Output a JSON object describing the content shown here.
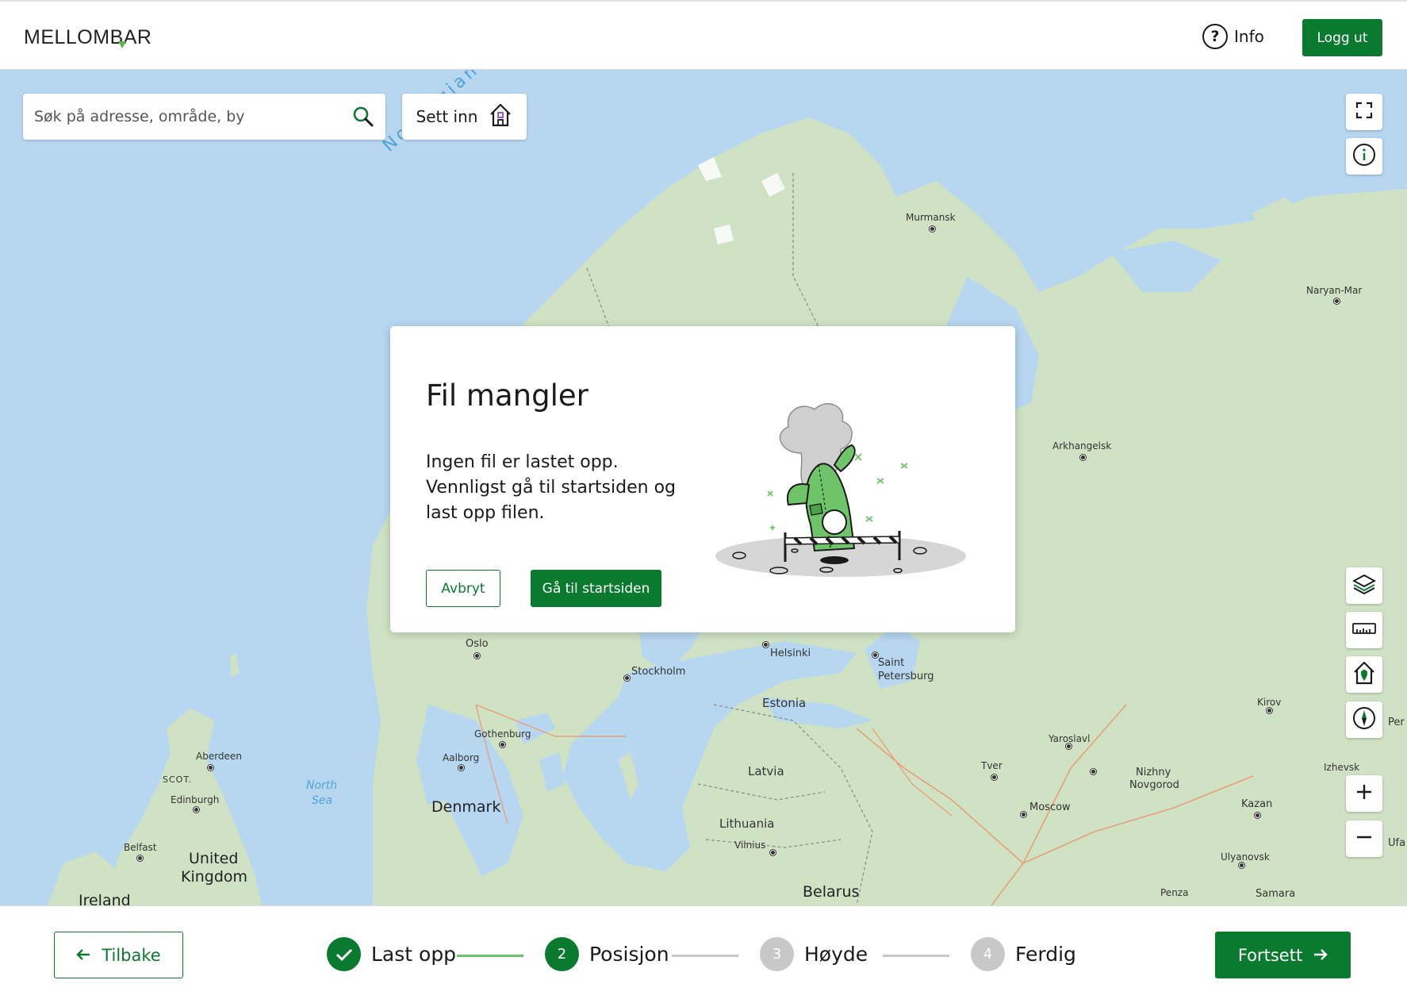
{
  "header": {
    "logo": "MELLOMBAR",
    "info_label": "Info",
    "logout_label": "Logg ut"
  },
  "search": {
    "placeholder": "Søk på adresse, område, by",
    "value": ""
  },
  "insert_button": {
    "label": "Sett inn"
  },
  "map_labels": {
    "sea_norwegian": "Norwegian Se",
    "sea_north_1": "North",
    "sea_north_2": "Sea",
    "murmansk": "Murmansk",
    "naryan_mar": "Naryan-Mar",
    "arkhangelsk": "Arkhangelsk",
    "oslo": "Oslo",
    "stockholm": "Stockholm",
    "helsinki": "Helsinki",
    "saint_1": "Saint",
    "saint_2": "Petersburg",
    "estonia": "Estonia",
    "gothenburg": "Gothenburg",
    "aalborg": "Aalborg",
    "denmark": "Denmark",
    "latvia": "Latvia",
    "lithuania": "Lithuania",
    "vilnius": "Vilnius",
    "belarus": "Belarus",
    "aberdeen": "Aberdeen",
    "scot": "SCOT.",
    "edinburgh": "Edinburgh",
    "belfast": "Belfast",
    "uk_1": "United",
    "uk_2": "Kingdom",
    "ireland": "Ireland",
    "yaroslavl": "Yaroslavl",
    "tver": "Tver",
    "moscow": "Moscow",
    "nizhny_1": "Nizhny",
    "nizhny_2": "Novgorod",
    "kirov": "Kirov",
    "izhevsk": "Izhevsk",
    "kazan": "Kazan",
    "ulyanovsk": "Ulyanovsk",
    "penza": "Penza",
    "samara": "Samara",
    "perm": "Per",
    "ufa": "Ufa"
  },
  "modal": {
    "title": "Fil mangler",
    "message": "Ingen fil er lastet opp. Vennligst gå til startsiden og last opp filen.",
    "cancel_label": "Avbryt",
    "home_label": "Gå til startsiden"
  },
  "footer": {
    "back_label": "Tilbake",
    "next_label": "Fortsett",
    "steps": [
      {
        "number": "",
        "label": "Last opp",
        "state": "done"
      },
      {
        "number": "2",
        "label": "Posisjon",
        "state": "active"
      },
      {
        "number": "3",
        "label": "Høyde",
        "state": "pending"
      },
      {
        "number": "4",
        "label": "Ferdig",
        "state": "pending"
      }
    ]
  },
  "colors": {
    "primary": "#0a7a2e",
    "water": "#b7d7f1",
    "land": "#cfe3c4",
    "pending": "#c8c8c8",
    "progress_done": "#6cc46a"
  }
}
